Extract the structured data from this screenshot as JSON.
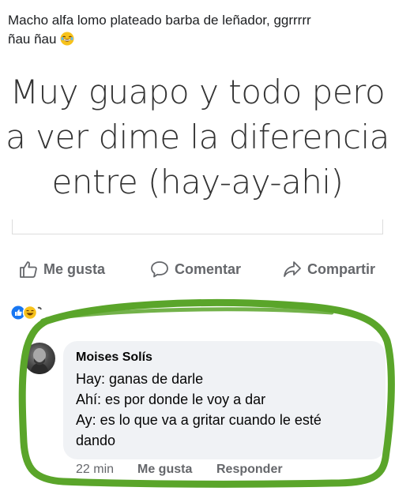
{
  "post": {
    "caption_line1": "Macho alfa lomo plateado barba de leñador, ggrrrrr",
    "caption_line2": "ñau ñau",
    "caption_emoji": "laughing-emoji",
    "image_text": [
      "Muy guapo y todo pero",
      "a ver dime la diferencia",
      "entre (hay-ay-ahi)"
    ]
  },
  "actions": {
    "like": "Me gusta",
    "comment": "Comentar",
    "share": "Compartir"
  },
  "reactions": [
    "like-reaction-icon",
    "haha-reaction-icon"
  ],
  "comment": {
    "author": "Moises Solís",
    "lines": [
      "Hay: ganas de darle",
      "Ahí: es por donde le voy a dar",
      "Ay: es lo que va a gritar cuando le esté",
      "dando"
    ],
    "time": "22 min",
    "like_label": "Me gusta",
    "reply_label": "Responder"
  },
  "colors": {
    "accent_blue": "#1877f2",
    "icon_gray": "#65676b",
    "scribble_green": "#5aa52a"
  }
}
